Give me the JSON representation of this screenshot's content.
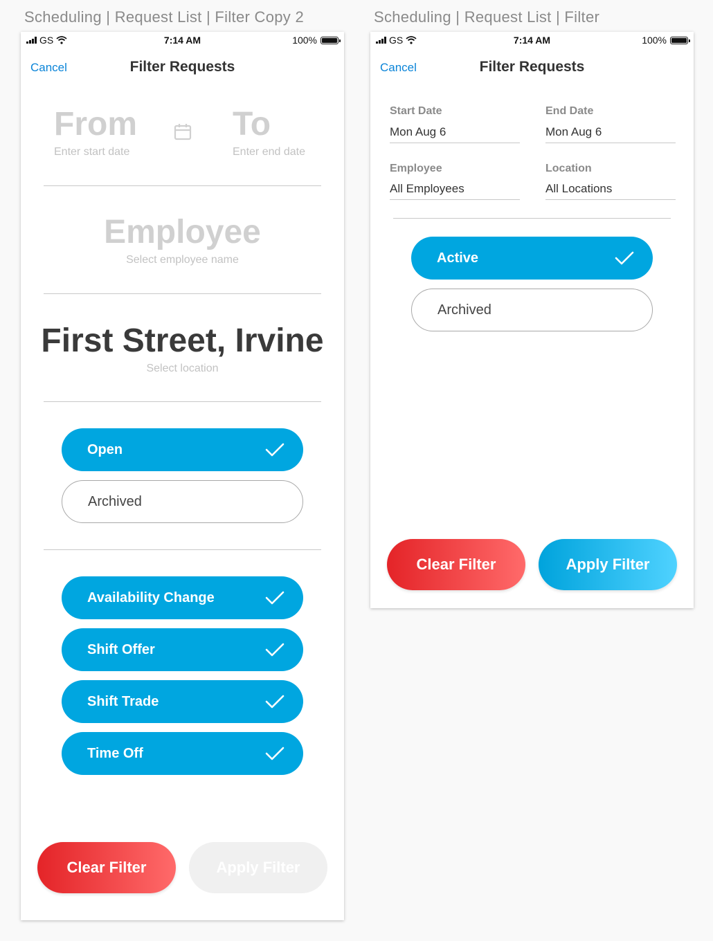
{
  "artboards": {
    "left_title": "Scheduling | Request List | Filter Copy 2",
    "right_title": "Scheduling | Request List | Filter"
  },
  "status_bar": {
    "carrier": "GS",
    "time": "7:14 AM",
    "battery": "100%"
  },
  "nav": {
    "cancel_label": "Cancel",
    "title": "Filter Requests"
  },
  "screen1": {
    "date": {
      "from_label": "From",
      "from_hint": "Enter start date",
      "to_label": "To",
      "to_hint": "Enter end date"
    },
    "employee": {
      "label": "Employee",
      "hint": "Select employee name"
    },
    "location": {
      "value": "First Street, Irvine",
      "hint": "Select location"
    },
    "status_options": [
      {
        "label": "Open",
        "selected": true
      },
      {
        "label": "Archived",
        "selected": false
      }
    ],
    "type_options": [
      {
        "label": "Availability Change",
        "selected": true
      },
      {
        "label": "Shift Offer",
        "selected": true
      },
      {
        "label": "Shift Trade",
        "selected": true
      },
      {
        "label": "Time Off",
        "selected": true
      }
    ],
    "clear_label": "Clear Filter",
    "apply_label": "Apply Filter",
    "apply_enabled": false
  },
  "screen2": {
    "start_date": {
      "label": "Start Date",
      "value": "Mon Aug 6"
    },
    "end_date": {
      "label": "End Date",
      "value": "Mon Aug 6"
    },
    "employee": {
      "label": "Employee",
      "value": "All Employees"
    },
    "location": {
      "label": "Location",
      "value": "All Locations"
    },
    "status_options": [
      {
        "label": "Active",
        "selected": true
      },
      {
        "label": "Archived",
        "selected": false
      }
    ],
    "clear_label": "Clear Filter",
    "apply_label": "Apply Filter",
    "apply_enabled": true
  },
  "colors": {
    "accent_blue": "#00a6e0",
    "link_blue": "#0a84d8",
    "clear_red": "#e42428"
  },
  "icons": [
    "signal-icon",
    "wifi-icon",
    "battery-icon",
    "calendar-icon",
    "checkmark-icon"
  ]
}
